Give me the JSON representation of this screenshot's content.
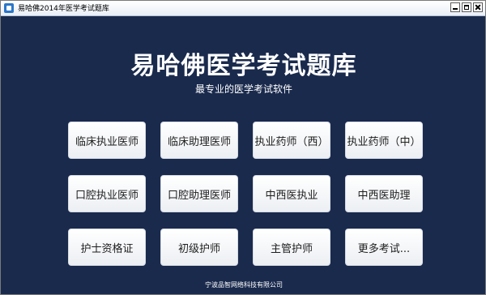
{
  "window": {
    "title": "易哈佛2014年医学考试题库",
    "controls": [
      "minimize-icon",
      "maximize-icon",
      "close-icon"
    ]
  },
  "header": {
    "title": "易哈佛医学考试题库",
    "subtitle": "最专业的医学考试软件"
  },
  "buttons": [
    {
      "label": "临床执业医师"
    },
    {
      "label": "临床助理医师"
    },
    {
      "label": "执业药师（西）"
    },
    {
      "label": "执业药师（中）"
    },
    {
      "label": "口腔执业医师"
    },
    {
      "label": "口腔助理医师"
    },
    {
      "label": "中西医执业"
    },
    {
      "label": "中西医助理"
    },
    {
      "label": "护士资格证"
    },
    {
      "label": "初级护师"
    },
    {
      "label": "主管护师"
    },
    {
      "label": "更多考试..."
    }
  ],
  "footer": {
    "text": "宁波品智网络科技有限公司"
  },
  "colors": {
    "background": "#1a2a4d",
    "button": "#ffffff",
    "text_light": "#ffffff"
  }
}
